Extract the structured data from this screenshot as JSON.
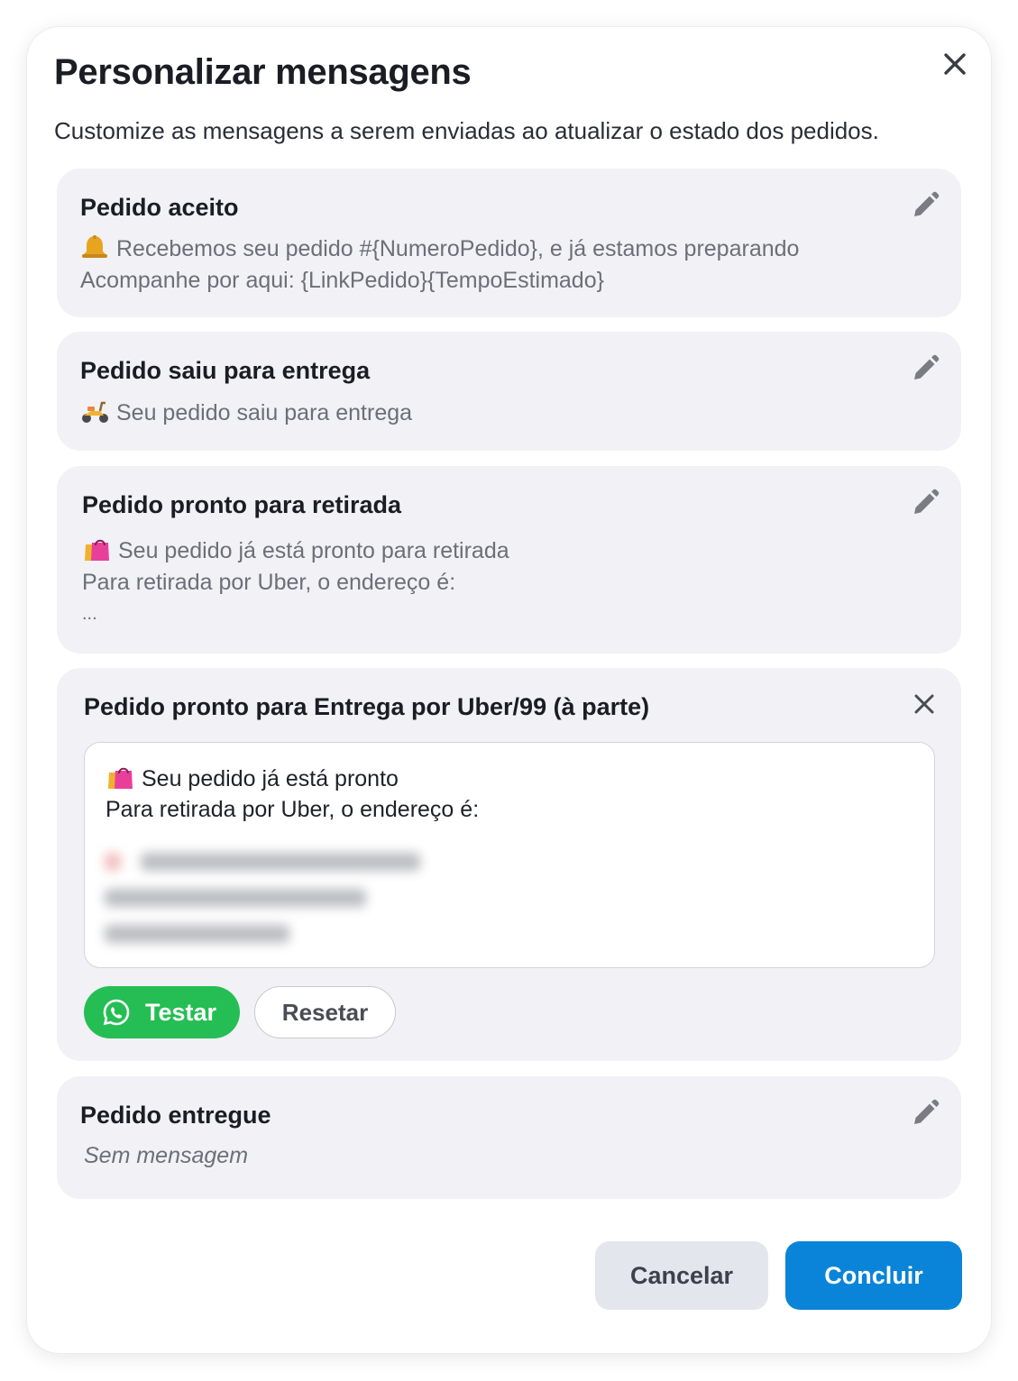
{
  "dialog": {
    "title": "Personalizar mensagens",
    "subtitle": "Customize as mensagens a serem enviadas ao atualizar o estado dos pedidos."
  },
  "cards": {
    "accepted": {
      "title": "Pedido aceito",
      "emoji_icon": "bell-icon",
      "line1": "Recebemos seu pedido #{NumeroPedido}, e já estamos preparando",
      "line2": "Acompanhe por aqui: {LinkPedido}{TempoEstimado}"
    },
    "out_for_delivery": {
      "title": "Pedido saiu para entrega",
      "emoji_icon": "scooter-icon",
      "line1": "Seu pedido saiu para entrega"
    },
    "ready_pickup": {
      "title": "Pedido pronto para retirada",
      "emoji_icon": "shopping-bags-icon",
      "line1": "Seu pedido já está pronto para retirada",
      "line2": "Para retirada por Uber, o endereço é:",
      "line3": "..."
    },
    "ready_uber": {
      "title": "Pedido pronto para Entrega por Uber/99 (à parte)",
      "emoji_icon": "shopping-bags-icon",
      "editor_line1": "Seu pedido já está pronto",
      "editor_line2": "Para retirada por Uber, o endereço é:",
      "test_label": "Testar",
      "reset_label": "Resetar"
    },
    "delivered": {
      "title": "Pedido entregue",
      "empty_text": "Sem mensagem"
    }
  },
  "footer": {
    "cancel_label": "Cancelar",
    "done_label": "Concluir"
  },
  "colors": {
    "primary": "#0a84d8",
    "whatsapp": "#25be54",
    "card_bg": "#f1f1f6"
  }
}
